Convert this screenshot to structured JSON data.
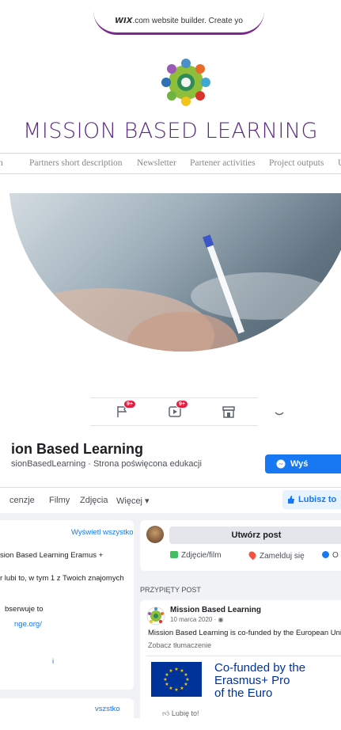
{
  "wix_banner": {
    "brand": "WIX",
    "text": ".com website builder. Create yo"
  },
  "site": {
    "title": "MISSION BASED LEARNING"
  },
  "nav": {
    "items": [
      "n",
      "Partners short description",
      "Newsletter",
      "Partener activities",
      "Project outputs",
      "U"
    ]
  },
  "fb_icons": {
    "badge1": "9+",
    "badge2": "9+"
  },
  "fb_page": {
    "name": "ion Based Learning",
    "subtitle": "sionBasedLearning · Strona poświęcona edukacji",
    "message_button": "Wyś",
    "tabs": [
      "cenzje",
      "Filmy",
      "Zdjęcia",
      "Więcej ▾"
    ],
    "like_button": "Lubisz to"
  },
  "left_card": {
    "show_all": "Wyświetl wszystko",
    "line1": "sion Based Learning Eramus +",
    "line2": "r lubi to, w tym 1 z Twoich znajomych",
    "line3": "bserwuje to",
    "line4": "nge.org/",
    "line5": "i",
    "show_all2": "vszstko"
  },
  "composer": {
    "create_post": "Utwórz post",
    "photo_video": "Zdjęcie/film",
    "check_in": "Zamelduj się",
    "tag": "O"
  },
  "pinned": {
    "label": "PRZYPIĘTY POST",
    "author": "Mission Based Learning",
    "date": "10 marca 2020 · ",
    "text": "Mission Based Learning is co-funded by the European Union.",
    "translate": "Zobacz tłumaczenie",
    "eu_line1": "Co-funded by the",
    "eu_line2": "Erasmus+ Pro",
    "eu_line3": "of the Euro",
    "like_action": "Lubię to!"
  },
  "colors": {
    "purple": "#5b2a83",
    "fb_blue": "#1877f2",
    "eu_blue": "#003399",
    "eu_yellow": "#ffcc00"
  }
}
